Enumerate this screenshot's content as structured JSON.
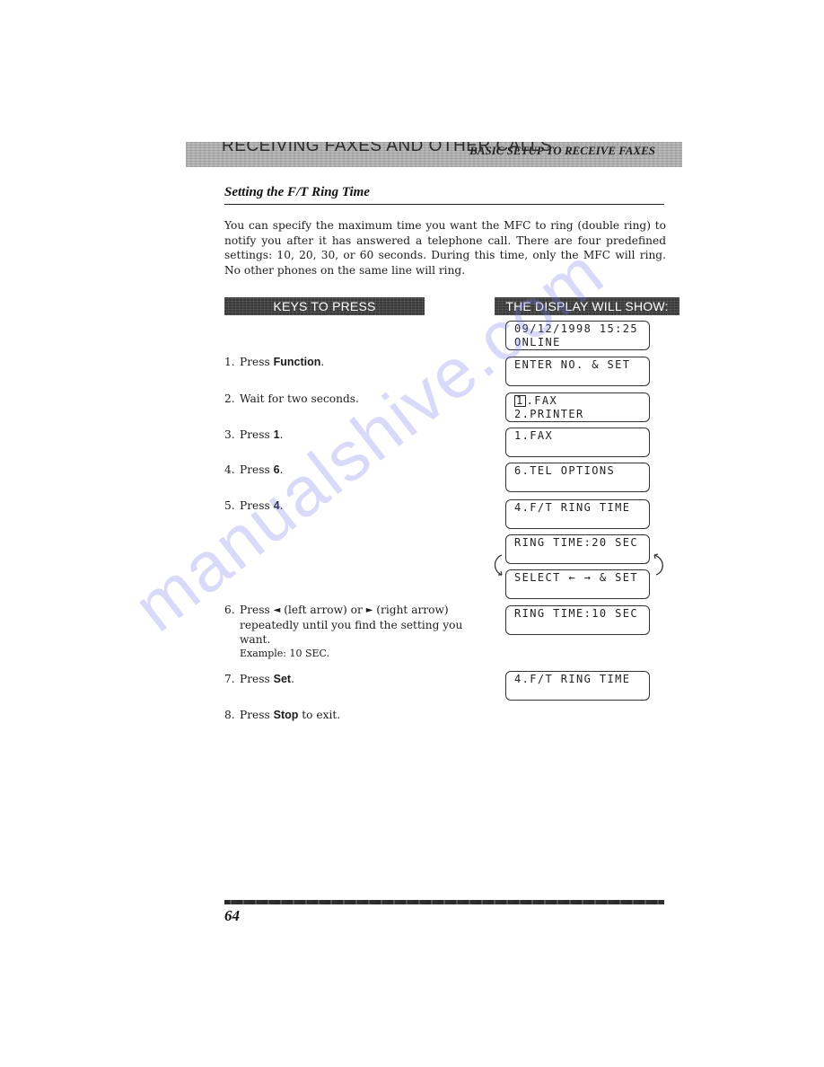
{
  "header": {
    "chapter": "RECEIVING FAXES AND OTHER CALLS",
    "section": "BASIC SETUP TO RECEIVE FAXES"
  },
  "section_title": "Setting the F/T Ring Time",
  "intro": "You can specify the maximum time you want the MFC to ring (double ring) to notify you after it has answered a telephone call. There are four predefined settings: 10, 20, 30, or 60 seconds. During this time, only the MFC will ring. No other phones on the same line will ring.",
  "columns": {
    "keys_banner": "KEYS TO PRESS",
    "display_banner": "THE DISPLAY WILL SHOW:"
  },
  "steps": [
    {
      "num": "1.",
      "pre": "Press ",
      "key": "Function",
      "post": "."
    },
    {
      "num": "2.",
      "pre": "Wait for two seconds.",
      "key": "",
      "post": ""
    },
    {
      "num": "3.",
      "pre": "Press ",
      "key": "1",
      "post": "."
    },
    {
      "num": "4.",
      "pre": "Press ",
      "key": "6",
      "post": "."
    },
    {
      "num": "5.",
      "pre": "Press ",
      "key": "4",
      "post": "."
    },
    {
      "num": "6.",
      "pre": "Press ",
      "left_arrow_icon": "◄",
      "mid": " (left arrow) or ",
      "right_arrow_icon": "►",
      "post": " (right arrow)",
      "cont": "repeatedly until you find the setting you want.",
      "example": "Example: 10 SEC."
    },
    {
      "num": "7.",
      "pre": "Press ",
      "key": "Set",
      "post": "."
    },
    {
      "num": "8.",
      "pre": "Press ",
      "key": "Stop",
      "post": " to exit."
    }
  ],
  "displays": [
    {
      "line1": "09/12/1998 15:25",
      "line2": "ONLINE"
    },
    {
      "line1": "ENTER NO. & SET",
      "line2": ""
    },
    {
      "cursor": "1",
      "line1": ".FAX",
      "line2": "2.PRINTER"
    },
    {
      "line1": "1.FAX",
      "line2": ""
    },
    {
      "line1": "6.TEL OPTIONS",
      "line2": ""
    },
    {
      "line1": "4.F/T RING TIME",
      "line2": ""
    },
    {
      "line1": "RING TIME:20 SEC",
      "line2": ""
    },
    {
      "line1": "SELECT ← → & SET",
      "line2": ""
    },
    {
      "line1": "RING TIME:10 SEC",
      "line2": ""
    },
    {
      "line1": "4.F/T RING TIME",
      "line2": ""
    }
  ],
  "footer": {
    "page_number": "64"
  },
  "watermark": "manualshive.com"
}
